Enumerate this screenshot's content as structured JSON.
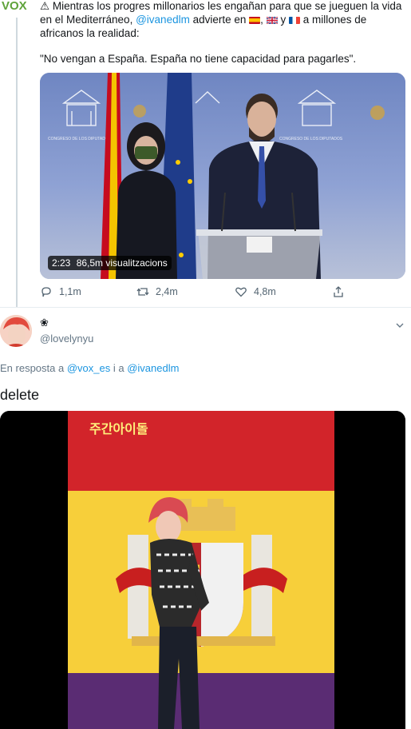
{
  "tweet1": {
    "logo_text": "VOX",
    "text_prefix": "⚠ Mientras los progres millonarios les engañan para que se jueguen la vida en el Mediterráneo,",
    "mention": "@ivanedlm",
    "text_mid": "advierte en",
    "y_text": "y",
    "text_suffix": "a millones de africanos la realidad:",
    "quote": "\"No vengan a España. España no tiene capacidad para pagarles\".",
    "video": {
      "duration": "2:23",
      "views": "86,5m visualitzacions"
    },
    "actions": {
      "reply_count": "1,1m",
      "retweet_count": "2,4m",
      "like_count": "4,8m"
    }
  },
  "tweet2": {
    "display_name": "❀",
    "handle": "@lovelynyu",
    "reply_prefix": "En resposta a",
    "reply_mention_1": "@vox_es",
    "reply_and": "i a",
    "reply_mention_2": "@ivanedlm",
    "text": "delete",
    "media_caption": "주간아이돌"
  },
  "colors": {
    "accent": "#1b95e0",
    "muted": "#657786",
    "divider": "#e6ecf0"
  }
}
